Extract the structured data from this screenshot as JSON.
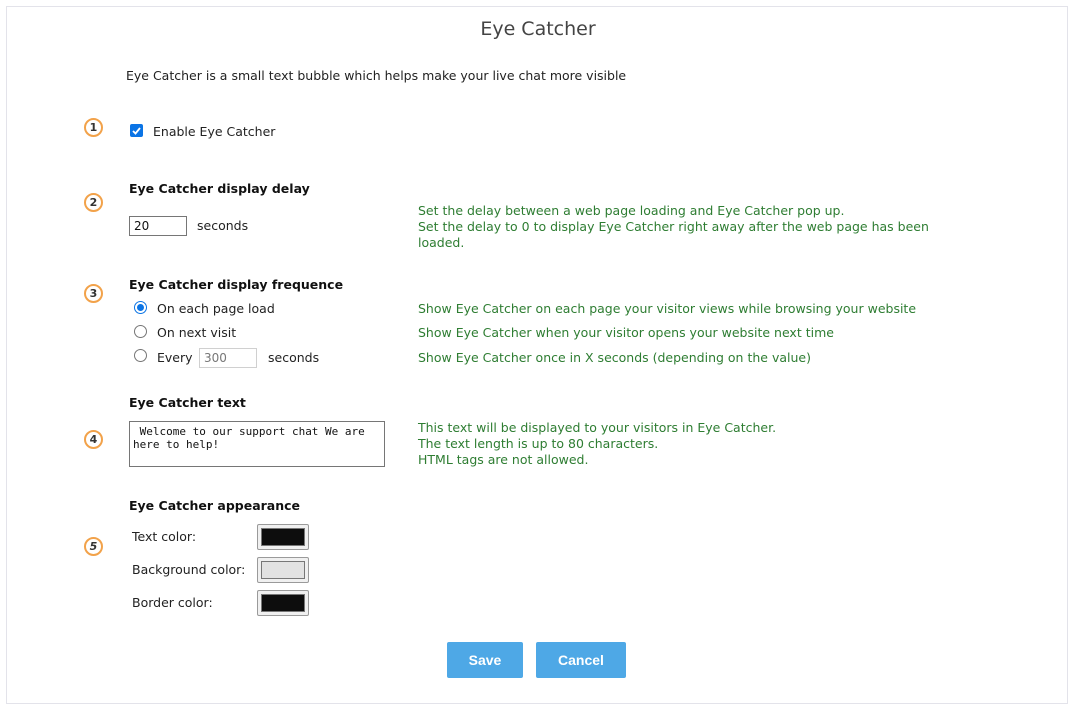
{
  "title": "Eye Catcher",
  "intro": "Eye Catcher is a small text bubble which helps make your live chat more visible",
  "steps": [
    "1",
    "2",
    "3",
    "4",
    "5"
  ],
  "enable": {
    "label": "Enable Eye Catcher",
    "checked": true
  },
  "delay": {
    "heading": "Eye Catcher display delay",
    "value": "20",
    "unit": "seconds",
    "help": [
      "Set the delay between a web page loading and Eye Catcher pop up.",
      "Set the delay to 0 to display Eye Catcher right away after the web page has been",
      "loaded."
    ]
  },
  "frequence": {
    "heading": "Eye Catcher display frequence",
    "options": [
      {
        "label": "On each page load",
        "checked": true,
        "help": "Show Eye Catcher on each page your visitor views while browsing your website"
      },
      {
        "label": "On next visit",
        "checked": false,
        "help": "Show Eye Catcher when your visitor opens your website next time"
      },
      {
        "label": "Every",
        "checked": false,
        "value": "300",
        "unit": "seconds",
        "help": "Show Eye Catcher once in X seconds (depending on the value)"
      }
    ]
  },
  "text": {
    "heading": "Eye Catcher text",
    "value": " Welcome to our support chat We are here to help!",
    "help": [
      "This text will be displayed to your visitors in Eye Catcher.",
      "The text length is up to 80 characters.",
      "HTML tags are not allowed."
    ]
  },
  "appearance": {
    "heading": "Eye Catcher appearance",
    "text_color": {
      "label": "Text color:",
      "color": "#0d0d0d"
    },
    "background_color": {
      "label": "Background color:",
      "color": "#e2e2e2"
    },
    "border_color": {
      "label": "Border color:",
      "color": "#0d0d0d"
    }
  },
  "buttons": {
    "save": "Save",
    "cancel": "Cancel"
  },
  "colors": {
    "accent": "#4ea8e6",
    "help_text": "#2e7d32",
    "badge_border": "#f2a24a",
    "checkbox": "#0b74e5"
  }
}
